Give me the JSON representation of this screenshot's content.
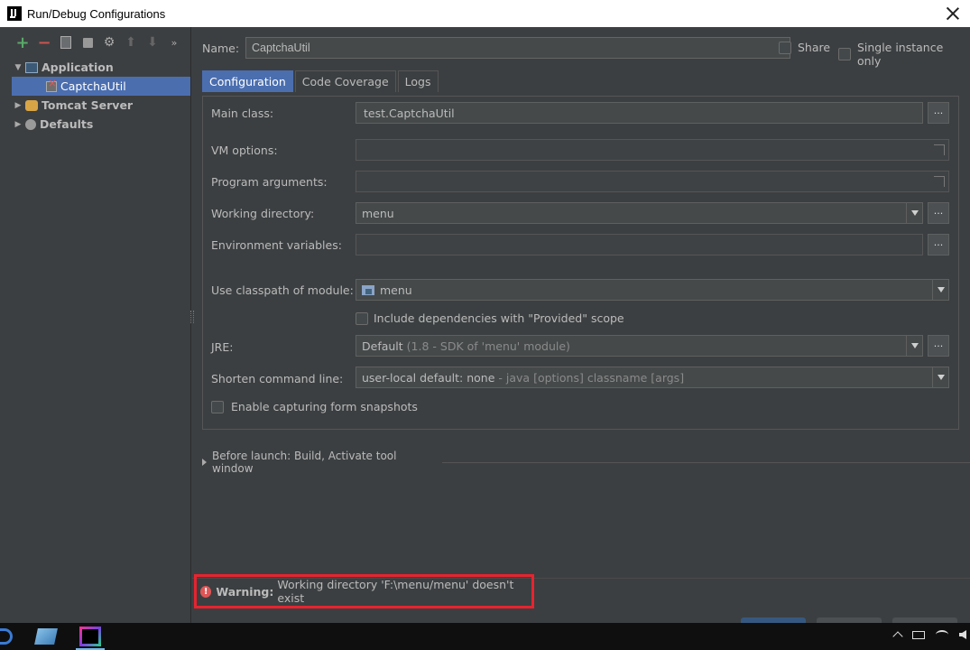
{
  "window": {
    "title": "Run/Debug Configurations"
  },
  "tree": {
    "application": "Application",
    "captcha_util": "CaptchaUtil",
    "tomcat": "Tomcat Server",
    "defaults": "Defaults"
  },
  "toolbar": {
    "more": "»"
  },
  "name": {
    "label": "Name:",
    "value": "CaptchaUtil"
  },
  "options": {
    "share": "Share",
    "single_instance": "Single instance only"
  },
  "tabs": [
    "Configuration",
    "Code Coverage",
    "Logs"
  ],
  "config": {
    "main_class_label": "Main class:",
    "main_class_value": "test.CaptchaUtil",
    "vm_options_label": "VM options:",
    "program_args_label": "Program arguments:",
    "working_dir_label": "Working directory:",
    "working_dir_value": "menu",
    "env_vars_label": "Environment variables:",
    "classpath_label": "Use classpath of module:",
    "classpath_value": "menu",
    "include_deps_label": "Include dependencies with \"Provided\" scope",
    "jre_label": "JRE:",
    "jre_value": "Default",
    "jre_detail": "(1.8 - SDK of 'menu' module)",
    "shorten_label": "Shorten command line:",
    "shorten_value": "user-local default: none",
    "shorten_detail": "- java [options] classname [args]",
    "snapshots_label": "Enable capturing form snapshots",
    "dots": "..."
  },
  "before_launch": "Before launch: Build, Activate tool window",
  "warning": {
    "prefix": "Warning:",
    "message": "Working directory 'F:\\menu/menu' doesn't exist"
  },
  "colors": {
    "accent": "#4b6eaf",
    "warning_border": "#e8232f",
    "bg": "#3c3f41"
  }
}
